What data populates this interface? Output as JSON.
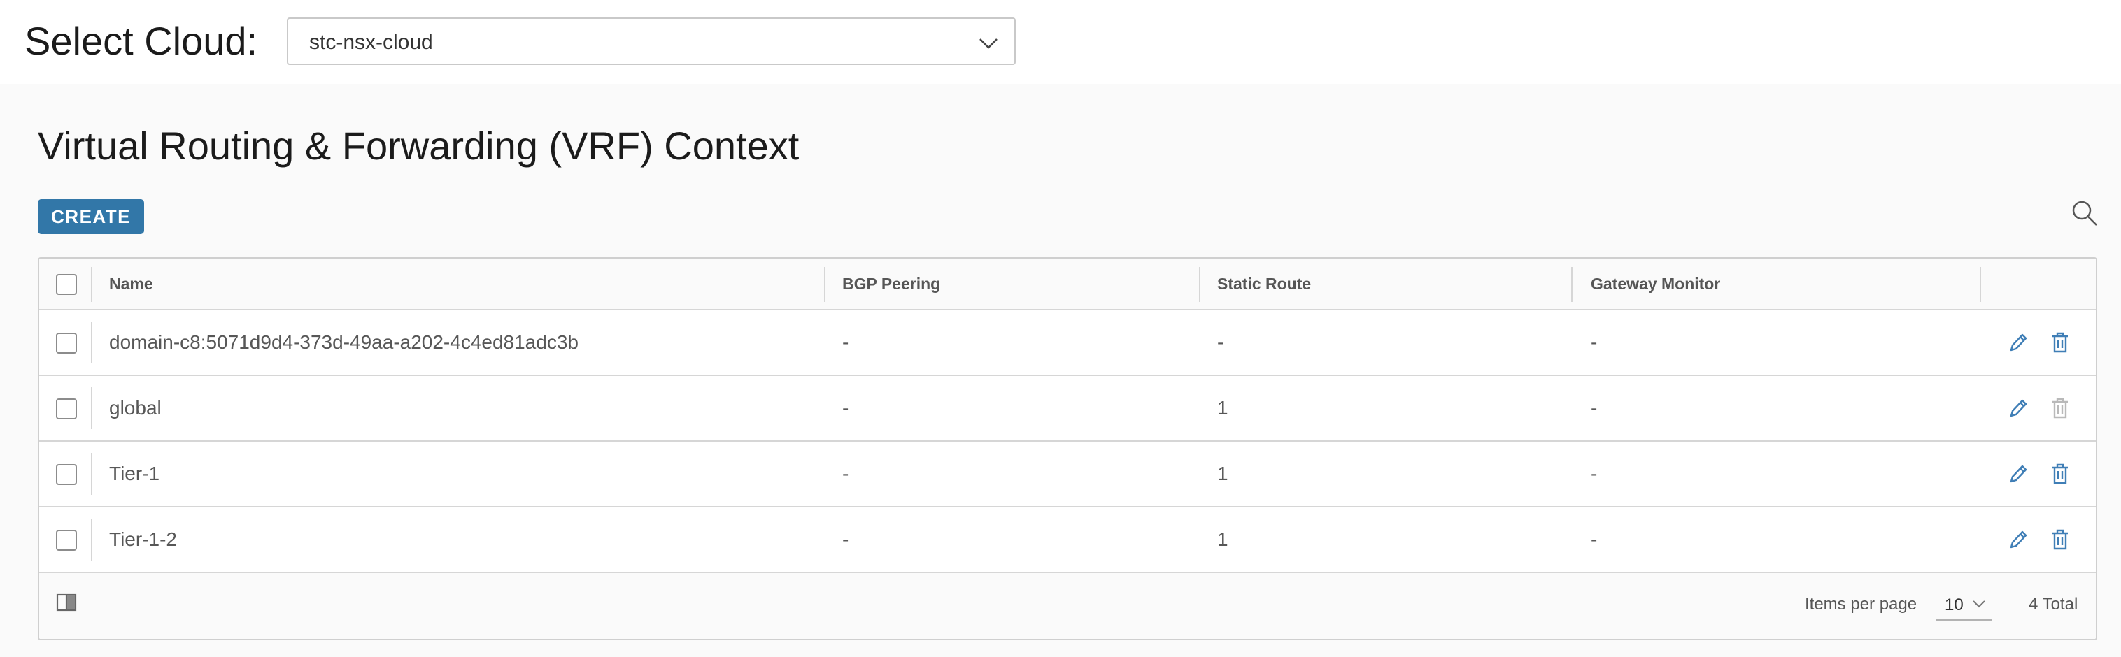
{
  "cloud": {
    "label": "Select Cloud:",
    "selected": "stc-nsx-cloud"
  },
  "page": {
    "title": "Virtual Routing & Forwarding (VRF) Context",
    "create_label": "CREATE"
  },
  "table": {
    "columns": [
      "Name",
      "BGP Peering",
      "Static Route",
      "Gateway Monitor"
    ],
    "rows": [
      {
        "name": "domain-c8:5071d9d4-373d-49aa-a202-4c4ed81adc3b",
        "bgp": "-",
        "static": "-",
        "gateway": "-",
        "delete_enabled": true
      },
      {
        "name": "global",
        "bgp": "-",
        "static": "1",
        "gateway": "-",
        "delete_enabled": false
      },
      {
        "name": "Tier-1",
        "bgp": "-",
        "static": "1",
        "gateway": "-",
        "delete_enabled": true
      },
      {
        "name": "Tier-1-2",
        "bgp": "-",
        "static": "1",
        "gateway": "-",
        "delete_enabled": true
      }
    ]
  },
  "footer": {
    "items_per_page_label": "Items per page",
    "items_per_page_value": "10",
    "total": "4 Total"
  },
  "icons": {
    "dropdown": "chevron-down-icon",
    "search": "search-icon",
    "edit": "pencil-icon",
    "delete": "trash-icon",
    "columns": "column-toggle-icon"
  },
  "colors": {
    "primary": "#3277a8",
    "action_icon": "#3f7eb6",
    "disabled_icon": "#b9b9b9"
  }
}
